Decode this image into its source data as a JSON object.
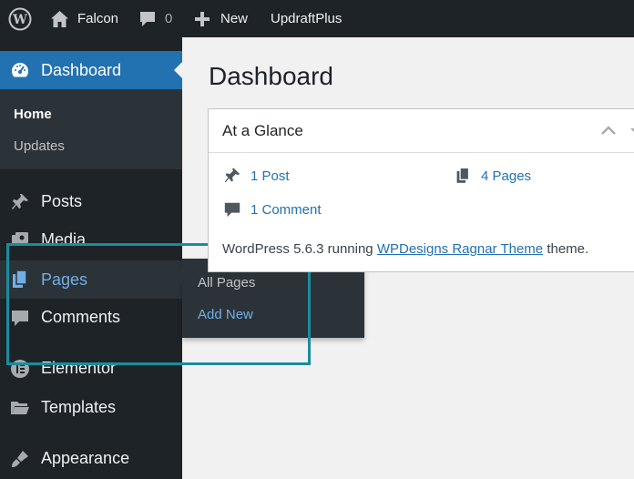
{
  "admin_bar": {
    "site_name": "Falcon",
    "comment_count": "0",
    "new_label": "New",
    "plugin_label": "UpdraftPlus"
  },
  "sidebar": {
    "dashboard": "Dashboard",
    "dashboard_sub": [
      "Home",
      "Updates"
    ],
    "items": [
      "Posts",
      "Media",
      "Pages",
      "Comments",
      "Elementor",
      "Templates",
      "Appearance"
    ]
  },
  "flyout": {
    "items": [
      "All Pages",
      "Add New"
    ]
  },
  "main": {
    "title": "Dashboard",
    "glance": {
      "title": "At a Glance",
      "posts": "1 Post",
      "pages": "4 Pages",
      "comments": "1 Comment",
      "footer_prefix": "WordPress 5.6.3 running",
      "theme_link": "WPDesigns Ragnar Theme",
      "footer_suffix": "theme."
    }
  },
  "colors": {
    "admin_bar": "#1d2327",
    "active_menu": "#2271b1",
    "link": "#2271b1",
    "highlight_box": "#1a8ca0"
  }
}
